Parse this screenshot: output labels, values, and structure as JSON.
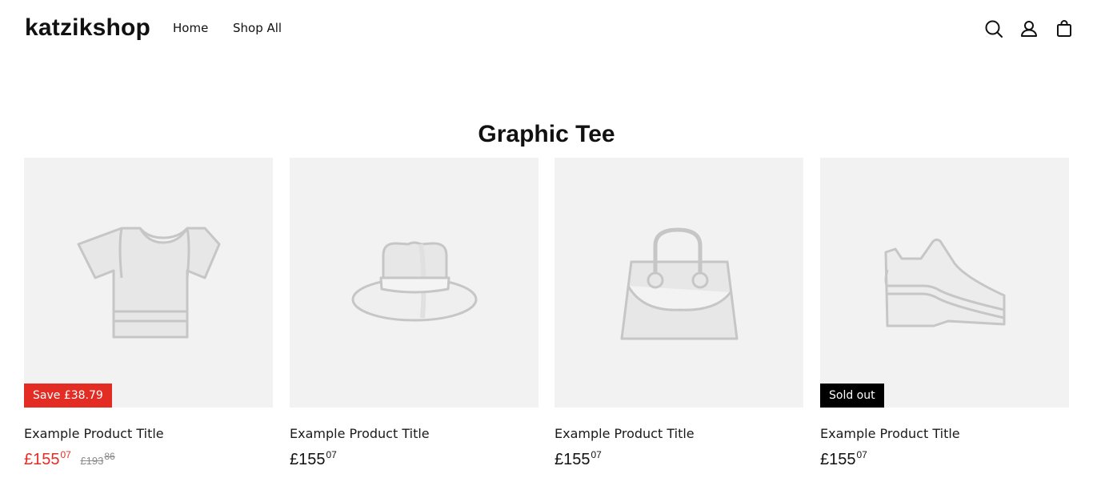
{
  "header": {
    "logo": "katzikshop",
    "nav": [
      {
        "label": "Home"
      },
      {
        "label": "Shop All"
      }
    ],
    "icons": [
      "search-icon",
      "account-icon",
      "cart-icon"
    ]
  },
  "collection": {
    "title": "Graphic Tee"
  },
  "products": [
    {
      "title": "Example Product Title",
      "price_main": "£155",
      "price_cents": "07",
      "compare_main": "£193",
      "compare_cents": "86",
      "badge": "Save £38.79",
      "badge_type": "sale",
      "image": "tshirt-icon"
    },
    {
      "title": "Example Product Title",
      "price_main": "£155",
      "price_cents": "07",
      "image": "hat-icon"
    },
    {
      "title": "Example Product Title",
      "price_main": "£155",
      "price_cents": "07",
      "image": "handbag-icon"
    },
    {
      "title": "Example Product Title",
      "price_main": "£155",
      "price_cents": "07",
      "badge": "Sold out",
      "badge_type": "soldout",
      "image": "shoe-icon"
    }
  ],
  "colors": {
    "sale": "#e32c23",
    "soldout_badge": "#000000",
    "placeholder_bg": "#f2f2f2",
    "placeholder_stroke": "#c6c6c6"
  }
}
